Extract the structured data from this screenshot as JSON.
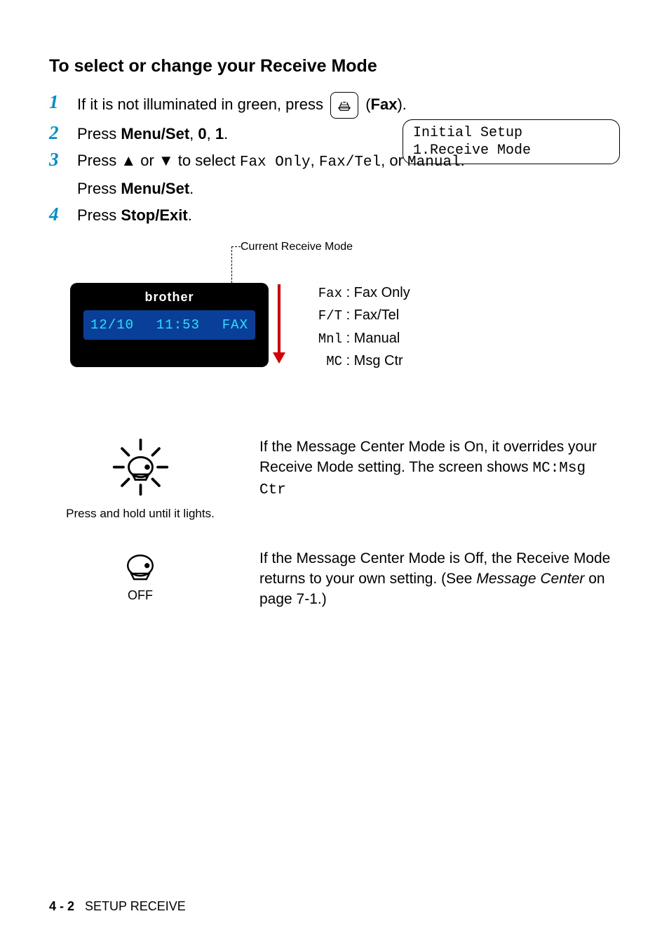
{
  "heading": "To select or change your Receive Mode",
  "steps": {
    "n1": "1",
    "s1a": "If it is not illuminated in green, press ",
    "s1b": " (",
    "s1c": "Fax",
    "s1d": ").",
    "n2": "2",
    "s2a": "Press ",
    "s2b": "Menu/Set",
    "s2c": ", ",
    "s2d": "0",
    "s2e": ", ",
    "s2f": "1",
    "s2g": ".",
    "n3": "3",
    "s3a": "Press ▲ or ▼ to select ",
    "s3b": "Fax Only",
    "s3c": ", ",
    "s3d": "Fax/Tel",
    "s3e": ", or ",
    "s3f": "Manual",
    "s3g": ".",
    "s3h": "Press ",
    "s3i": "Menu/Set",
    "s3j": ".",
    "n4": "4",
    "s4a": "Press ",
    "s4b": "Stop/Exit",
    "s4c": "."
  },
  "lcd": {
    "line1": "Initial Setup",
    "line2": "1.Receive Mode"
  },
  "diagram": {
    "caption": "Current Receive Mode",
    "brand": "brother",
    "date": "12/10",
    "time": "11:53",
    "mode": "FAX",
    "modes": [
      {
        "code": "Fax",
        "label": ": Fax Only"
      },
      {
        "code": "F/T",
        "label": ": Fax/Tel"
      },
      {
        "code": "Mnl",
        "label": ": Manual"
      },
      {
        "code": "MC",
        "label": ": Msg Ctr"
      }
    ]
  },
  "mc_on": {
    "text_a": "If the Message Center Mode is On, it overrides your Receive Mode setting. The screen shows ",
    "text_b": "MC:Msg Ctr",
    "caption": "Press and hold until it lights."
  },
  "mc_off": {
    "label": "OFF",
    "text_a": "If the Message Center Mode is Off, the Receive Mode returns to your own setting. (See ",
    "text_b": "Message Center",
    "text_c": " on page 7-1.)"
  },
  "footer": {
    "page": "4 - 2",
    "chapter": "SETUP RECEIVE"
  }
}
